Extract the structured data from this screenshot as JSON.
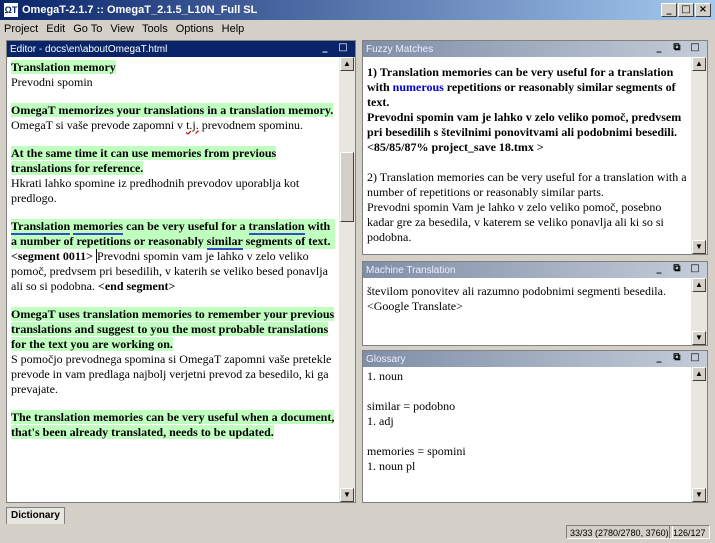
{
  "window": {
    "title": "OmegaT-2.1.7 :: OmegaT_2.1.5_L10N_Full SL",
    "icon": "omegat-app-icon",
    "controls": [
      "_",
      "□",
      "×"
    ]
  },
  "menu": [
    "Project",
    "Edit",
    "Go To",
    "View",
    "Tools",
    "Options",
    "Help"
  ],
  "editor": {
    "header": "Editor - docs\\en\\aboutOmegaT.html",
    "paragraphs": [
      {
        "source": "Translation memory",
        "target": "Prevodni spomin"
      },
      {
        "source": "OmegaT memorizes your translations in a translation memory.",
        "target": "OmegaT si vaše prevode zapomni v t.j. prevodnem spominu."
      },
      {
        "source": "At the same time it can use memories from previous translations for reference.",
        "target": "Hkrati lahko spomine iz predhodnih prevodov uporablja kot predlogo."
      },
      {
        "source_parts": [
          "Translation",
          "memories",
          "can be very useful for a",
          "translation",
          "with a number of repetitions or reasonably",
          "similar",
          "segments of text."
        ],
        "seg_open": "<segment 0011>",
        "target": "Prevodni spomin vam je lahko v zelo veliko pomoč, predvsem pri besedilih, v katerih se veliko besed ponavlja ali so si podobna.",
        "seg_close": "<end segment>"
      },
      {
        "source": "OmegaT uses translation memories to remember your previous translations and suggest to you the most probable translations for the text you are working on.",
        "target": "S pomočjo prevodnega spomina si OmegaT zapomni vaše pretekle prevode in vam predlaga najbolj verjetni prevod za besedilo, ki ga prevajate."
      },
      {
        "source": "The translation memories can be very useful when a document, that's been already translated, needs to be updated.",
        "target": ""
      }
    ]
  },
  "fuzzy": {
    "header": "Fuzzy Matches",
    "m1_a": "1) Translation memories can be very useful for a translation with ",
    "m1_blue": "numerous",
    "m1_b": " repetitions or reasonably similar segments of text.",
    "m1_target": "Prevodni spomin vam je lahko v zelo veliko pomoč, predvsem pri besedilih s številnimi ponovitvami ali podobnimi besedili.",
    "m1_meta": "<85/85/87% project_save 18.tmx >",
    "m2": "2) Translation memories can be very useful for a translation with a number of repetitions or reasonably similar parts.",
    "m2_target": "Prevodni spomin Vam je lahko v zelo veliko pomoč, posebno kadar gre za besedila, v katerem se veliko ponavlja ali ki so si podobna."
  },
  "mt": {
    "header": "Machine Translation",
    "text": "številom ponovitev ali razumno podobnimi segmenti besedila.",
    "source": "<Google Translate>"
  },
  "glossary": {
    "header": "Glossary",
    "lines": [
      "1. noun",
      "",
      "similar = podobno",
      "1. adj",
      "",
      "memories = spomini",
      "1. noun pl"
    ]
  },
  "status": {
    "tab": "Dictionary",
    "progress": "33/33 (2780/2780, 3760)",
    "segments": "126/127"
  }
}
